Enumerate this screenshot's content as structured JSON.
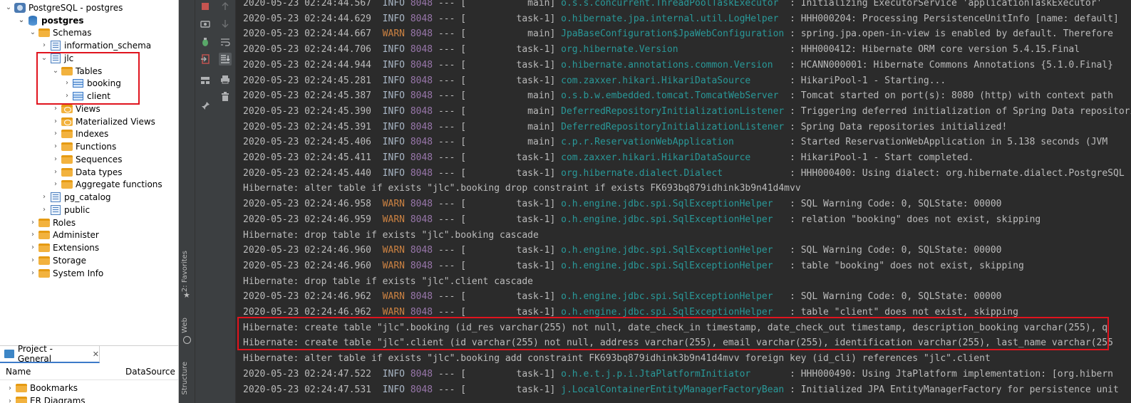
{
  "navigator": {
    "connection": "PostgreSQL - postgres",
    "database": "postgres",
    "schemas_label": "Schemas",
    "information_schema": "information_schema",
    "jlc": "jlc",
    "tables_label": "Tables",
    "table_booking": "booking",
    "table_client": "client",
    "views": "Views",
    "materialized_views": "Materialized Views",
    "indexes": "Indexes",
    "functions": "Functions",
    "sequences": "Sequences",
    "data_types": "Data types",
    "aggregate_functions": "Aggregate functions",
    "pg_catalog": "pg_catalog",
    "public": "public",
    "roles": "Roles",
    "administer": "Administer",
    "extensions": "Extensions",
    "storage": "Storage",
    "system_info": "System Info"
  },
  "project_panel": {
    "tab_title": "Project - General",
    "col_name": "Name",
    "col_datasource": "DataSource",
    "bookmarks": "Bookmarks",
    "er_diagrams": "ER Diagrams"
  },
  "side_tabs": {
    "favorites": "2: Favorites",
    "web": "Web",
    "structure": "Structure"
  },
  "console": {
    "lines": [
      {
        "date": "2020-05-23 02:24:44.567",
        "level": "INFO",
        "pid": "8048",
        "thread": "main",
        "logger": "o.s.s.concurrent.ThreadPoolTaskExecutor",
        "msg": ": Initializing ExecutorService 'applicationTaskExecutor'"
      },
      {
        "date": "2020-05-23 02:24:44.629",
        "level": "INFO",
        "pid": "8048",
        "thread": "task-1",
        "logger": "o.hibernate.jpa.internal.util.LogHelper",
        "msg": ": HHH000204: Processing PersistenceUnitInfo [name: default]"
      },
      {
        "date": "2020-05-23 02:24:44.667",
        "level": "WARN",
        "pid": "8048",
        "thread": "main",
        "logger": "JpaBaseConfiguration$JpaWebConfiguration",
        "msg": ": spring.jpa.open-in-view is enabled by default. Therefore"
      },
      {
        "date": "2020-05-23 02:24:44.706",
        "level": "INFO",
        "pid": "8048",
        "thread": "task-1",
        "logger": "org.hibernate.Version",
        "msg": ": HHH000412: Hibernate ORM core version 5.4.15.Final"
      },
      {
        "date": "2020-05-23 02:24:44.944",
        "level": "INFO",
        "pid": "8048",
        "thread": "task-1",
        "logger": "o.hibernate.annotations.common.Version",
        "msg": ": HCANN000001: Hibernate Commons Annotations {5.1.0.Final}"
      },
      {
        "date": "2020-05-23 02:24:45.281",
        "level": "INFO",
        "pid": "8048",
        "thread": "task-1",
        "logger": "com.zaxxer.hikari.HikariDataSource",
        "msg": ": HikariPool-1 - Starting..."
      },
      {
        "date": "2020-05-23 02:24:45.387",
        "level": "INFO",
        "pid": "8048",
        "thread": "main",
        "logger": "o.s.b.w.embedded.tomcat.TomcatWebServer",
        "msg": ": Tomcat started on port(s): 8080 (http) with context path"
      },
      {
        "date": "2020-05-23 02:24:45.390",
        "level": "INFO",
        "pid": "8048",
        "thread": "main",
        "logger": "DeferredRepositoryInitializationListener",
        "msg": ": Triggering deferred initialization of Spring Data repositories"
      },
      {
        "date": "2020-05-23 02:24:45.391",
        "level": "INFO",
        "pid": "8048",
        "thread": "main",
        "logger": "DeferredRepositoryInitializationListener",
        "msg": ": Spring Data repositories initialized!"
      },
      {
        "date": "2020-05-23 02:24:45.406",
        "level": "INFO",
        "pid": "8048",
        "thread": "main",
        "logger": "c.p.r.ReservationWebApplication",
        "msg": ": Started ReservationWebApplication in 5.138 seconds (JVM"
      },
      {
        "date": "2020-05-23 02:24:45.411",
        "level": "INFO",
        "pid": "8048",
        "thread": "task-1",
        "logger": "com.zaxxer.hikari.HikariDataSource",
        "msg": ": HikariPool-1 - Start completed."
      },
      {
        "date": "2020-05-23 02:24:45.440",
        "level": "INFO",
        "pid": "8048",
        "thread": "task-1",
        "logger": "org.hibernate.dialect.Dialect",
        "msg": ": HHH000400: Using dialect: org.hibernate.dialect.PostgreSQL"
      },
      {
        "plain": "Hibernate: alter table if exists \"jlc\".booking drop constraint if exists FK693bq879idhink3b9n41d4mvv"
      },
      {
        "date": "2020-05-23 02:24:46.958",
        "level": "WARN",
        "pid": "8048",
        "thread": "task-1",
        "logger": "o.h.engine.jdbc.spi.SqlExceptionHelper",
        "msg": ": SQL Warning Code: 0, SQLState: 00000"
      },
      {
        "date": "2020-05-23 02:24:46.959",
        "level": "WARN",
        "pid": "8048",
        "thread": "task-1",
        "logger": "o.h.engine.jdbc.spi.SqlExceptionHelper",
        "msg": ": relation \"booking\" does not exist, skipping"
      },
      {
        "plain": "Hibernate: drop table if exists \"jlc\".booking cascade"
      },
      {
        "date": "2020-05-23 02:24:46.960",
        "level": "WARN",
        "pid": "8048",
        "thread": "task-1",
        "logger": "o.h.engine.jdbc.spi.SqlExceptionHelper",
        "msg": ": SQL Warning Code: 0, SQLState: 00000"
      },
      {
        "date": "2020-05-23 02:24:46.960",
        "level": "WARN",
        "pid": "8048",
        "thread": "task-1",
        "logger": "o.h.engine.jdbc.spi.SqlExceptionHelper",
        "msg": ": table \"booking\" does not exist, skipping"
      },
      {
        "plain": "Hibernate: drop table if exists \"jlc\".client cascade"
      },
      {
        "date": "2020-05-23 02:24:46.962",
        "level": "WARN",
        "pid": "8048",
        "thread": "task-1",
        "logger": "o.h.engine.jdbc.spi.SqlExceptionHelper",
        "msg": ": SQL Warning Code: 0, SQLState: 00000"
      },
      {
        "date": "2020-05-23 02:24:46.962",
        "level": "WARN",
        "pid": "8048",
        "thread": "task-1",
        "logger": "o.h.engine.jdbc.spi.SqlExceptionHelper",
        "msg": ": table \"client\" does not exist, skipping"
      },
      {
        "plain": "Hibernate: create table \"jlc\".booking (id_res varchar(255) not null, date_check_in timestamp, date_check_out timestamp, description_booking varchar(255), q"
      },
      {
        "plain": "Hibernate: create table \"jlc\".client (id varchar(255) not null, address varchar(255), email varchar(255), identification varchar(255), last_name varchar(255"
      },
      {
        "plain": "Hibernate: alter table if exists \"jlc\".booking add constraint FK693bq879idhink3b9n41d4mvv foreign key (id_cli) references \"jlc\".client"
      },
      {
        "date": "2020-05-23 02:24:47.522",
        "level": "INFO",
        "pid": "8048",
        "thread": "task-1",
        "logger": "o.h.e.t.j.p.i.JtaPlatformInitiator",
        "msg": ": HHH000490: Using JtaPlatform implementation: [org.hibern"
      },
      {
        "date": "2020-05-23 02:24:47.531",
        "level": "INFO",
        "pid": "8048",
        "thread": "task-1",
        "logger": "j.LocalContainerEntityManagerFactoryBean",
        "msg": ": Initialized JPA EntityManagerFactory for persistence unit"
      }
    ]
  }
}
